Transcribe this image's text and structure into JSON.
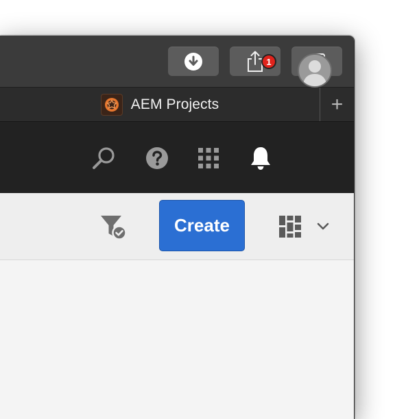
{
  "browser": {
    "toolbar": {
      "downloads_icon": "download-circle-icon",
      "share_icon": "share-icon",
      "tabs_icon": "tab-overview-icon"
    },
    "tab": {
      "title": "AEM Projects",
      "favicon": "aem-logo-icon"
    },
    "new_tab_label": "+"
  },
  "shell": {
    "search_icon": "search-icon",
    "help_icon": "help-icon",
    "solutions_icon": "grid-icon",
    "notifications": {
      "icon": "bell-icon",
      "count": "1",
      "badge_color": "#e0231c"
    },
    "avatar_icon": "user-avatar-icon"
  },
  "actions": {
    "filter_icon": "filter-check-icon",
    "create_label": "Create",
    "create_color": "#2b6fd3",
    "view_icon": "card-view-icon",
    "view_dropdown_icon": "chevron-down-icon"
  }
}
